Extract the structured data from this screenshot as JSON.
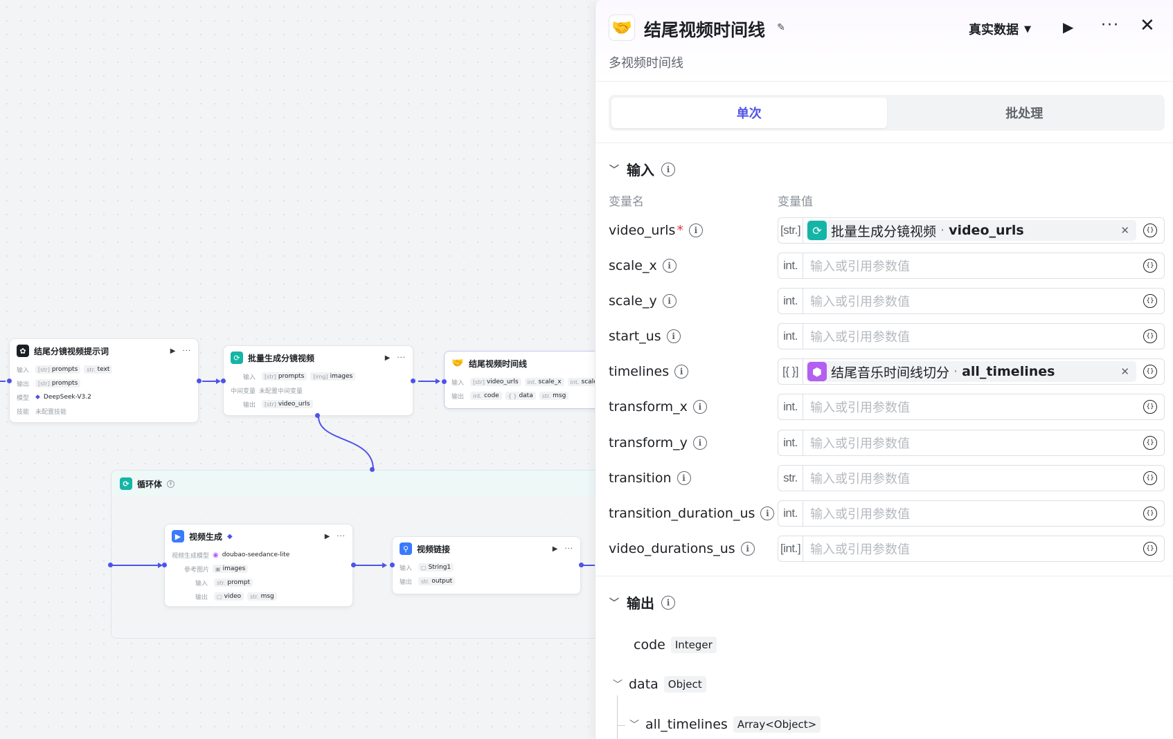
{
  "canvas": {
    "node1": {
      "title": "结尾分镜视频提示词",
      "input_label": "输入",
      "input_tags": [
        {
          "type": "[str]",
          "name": "prompts"
        },
        {
          "type": "str.",
          "name": "text"
        }
      ],
      "output_label": "输出",
      "output_tags": [
        {
          "type": "[str]",
          "name": "prompts"
        }
      ],
      "model_label": "模型",
      "model_value": "DeepSeek-V3.2",
      "skill_label": "技能",
      "skill_value": "未配置技能"
    },
    "node2": {
      "title": "批量生成分镜视频",
      "input_label": "输入",
      "input_tags": [
        {
          "type": "[str]",
          "name": "prompts"
        },
        {
          "type": "[img]",
          "name": "images"
        }
      ],
      "mid_label": "中间变量",
      "mid_value": "未配置中间变量",
      "output_label": "输出",
      "output_tags": [
        {
          "type": "[str]",
          "name": "video_urls"
        }
      ]
    },
    "node3": {
      "title": "结尾视频时间线",
      "input_label": "输入",
      "input_tags": [
        {
          "type": "[str]",
          "name": "video_urls"
        },
        {
          "type": "int.",
          "name": "scale_x"
        },
        {
          "type": "int.",
          "name": "scale_y"
        }
      ],
      "output_label": "输出",
      "output_tags": [
        {
          "type": "int.",
          "name": "code"
        },
        {
          "type": "{ }",
          "name": "data"
        },
        {
          "type": "str.",
          "name": "msg"
        }
      ]
    },
    "loop": {
      "title": "循环体"
    },
    "node4": {
      "title": "视频生成",
      "model_label": "视频生成模型",
      "model_value": "doubao-seedance-lite",
      "ref_label": "参考图片",
      "ref_value": "images",
      "input_label": "输入",
      "input_tags": [
        {
          "type": "str.",
          "name": "prompt"
        }
      ],
      "output_label": "输出",
      "output_tags": [
        {
          "type": "▢",
          "name": "video"
        },
        {
          "type": "str.",
          "name": "msg"
        }
      ]
    },
    "node5": {
      "title": "视频链接",
      "input_label": "输入",
      "input_tags": [
        {
          "type": "▢",
          "name": "String1"
        }
      ],
      "output_label": "输出",
      "output_tags": [
        {
          "type": "str.",
          "name": "output"
        }
      ]
    }
  },
  "panel": {
    "title": "结尾视频时间线",
    "subtitle": "多视频时间线",
    "mode_label": "真实数据",
    "tabs": [
      "单次",
      "批处理"
    ],
    "input_section": "输入",
    "col_name": "变量名",
    "col_value": "变量值",
    "params": [
      {
        "name": "video_urls",
        "required": true,
        "type": "[str.]",
        "ref": {
          "node": "批量生成分镜视频",
          "var": "video_urls",
          "color": "#14b5a6",
          "icon": "loop-icon"
        }
      },
      {
        "name": "scale_x",
        "type": "int.",
        "placeholder": "输入或引用参数值"
      },
      {
        "name": "scale_y",
        "type": "int.",
        "placeholder": "输入或引用参数值"
      },
      {
        "name": "start_us",
        "type": "int.",
        "placeholder": "输入或引用参数值"
      },
      {
        "name": "timelines",
        "type": "[{ }]",
        "ref": {
          "node": "结尾音乐时间线切分",
          "var": "all_timelines",
          "color": "#b35ff2",
          "icon": "cube-icon"
        }
      },
      {
        "name": "transform_x",
        "type": "int.",
        "placeholder": "输入或引用参数值"
      },
      {
        "name": "transform_y",
        "type": "int.",
        "placeholder": "输入或引用参数值"
      },
      {
        "name": "transition",
        "type": "str.",
        "placeholder": "输入或引用参数值"
      },
      {
        "name": "transition_duration_us",
        "type": "int.",
        "placeholder": "输入或引用参数值"
      },
      {
        "name": "video_durations_us",
        "type": "[int.]",
        "placeholder": "输入或引用参数值"
      }
    ],
    "output_section": "输出",
    "outputs": [
      {
        "name": "code",
        "type": "Integer"
      },
      {
        "name": "data",
        "type": "Object"
      },
      {
        "name": "all_timelines",
        "type": "Array<Object>"
      }
    ]
  },
  "colors": {
    "accent": "#4d53e8",
    "teal": "#14b5a6",
    "purple": "#b35ff2",
    "required": "#e0383e"
  }
}
